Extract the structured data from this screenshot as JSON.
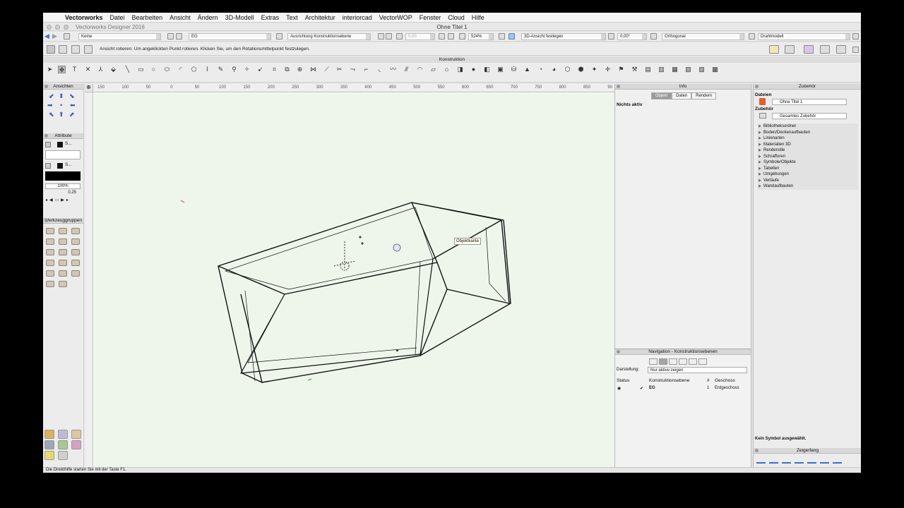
{
  "menubar": {
    "apple": "",
    "app": "Vectorworks",
    "items": [
      "Datei",
      "Bearbeiten",
      "Ansicht",
      "Ändern",
      "3D-Modell",
      "Extras",
      "Text",
      "Architektur",
      "interiorcad",
      "VectorWOP",
      "Fenster",
      "Cloud",
      "Hilfe"
    ]
  },
  "titlebar": {
    "app_version": "Vectorworks Designer 2016",
    "document": "Ohne Titel 1"
  },
  "modebar": {
    "klasse": "Keine",
    "ebene": "EG",
    "ausrichtung": "Ausrichtung Konstruktionsebene",
    "value_disabled": "0,00",
    "zoom": "524%",
    "ansicht": "3D-Ansicht festlegen",
    "winkel": "0,00°",
    "projektion": "Orthogonal",
    "darstellung": "Drahtmodell"
  },
  "hintbar": {
    "hint": "Ansicht rotieren: Um angeklickten Punkt rotieren. Klicken Sie, um den Rotationsmittelpunkt festzulegen."
  },
  "konstruktion": {
    "title": "Konstruktion"
  },
  "leftpanel": {
    "ansichten_title": "Ansichten",
    "attribute_title": "Attribute",
    "fill_label": "S...",
    "pen_label": "S...",
    "opacity": "100%",
    "line_weight": "0,25",
    "werkzeuggruppen_title": "Werkzeuggruppen"
  },
  "ruler": {
    "top_ticks": [
      "150",
      "100",
      "50",
      "0",
      "50",
      "100",
      "150",
      "200",
      "250",
      "300",
      "350",
      "400",
      "450",
      "500",
      "550",
      "600",
      "650",
      "700",
      "750",
      "800",
      "850",
      "90"
    ]
  },
  "canvas": {
    "tooltip": "Objektkante"
  },
  "info": {
    "title": "Info",
    "tabs": [
      "Objekt",
      "Daten",
      "Rendern"
    ],
    "status": "Nichts aktiv"
  },
  "nav": {
    "title": "Navigation - Konstruktionsebenen",
    "darstellung_label": "Darstellung:",
    "darstellung_value": "Nur aktive zeigen",
    "col_status": "Status",
    "col_ebene": "Konstruktionsebene",
    "col_nr": "#",
    "col_geschoss": "Geschoss",
    "row_check": "✔",
    "row_ebene": "EG",
    "row_nr": "1",
    "row_geschoss": "Erdgeschoss"
  },
  "zubehor": {
    "title": "Zubehör",
    "dateien_label": "Dateien",
    "datei_value": "Ohne Titel 1",
    "zubehor_label": "Zubehör",
    "zubehor_value": "Gesamtes Zubehör",
    "items": [
      "Bibliotheksordner",
      "Boden/Deckenaufbauten",
      "Linienarten",
      "Materialien 3D",
      "Renderstile",
      "Schraffuren",
      "Symbole/Objekte",
      "Tabellen",
      "Umgebungen",
      "Verläufe",
      "Wandaufbauten"
    ],
    "empty": "Kein Symbol ausgewählt.",
    "zeigerfang_title": "Zeigerfang"
  },
  "statusbar": {
    "text": "Die Direkthilfe starten Sie mit der Taste F1."
  },
  "colors": {
    "canvas_bg": "#eef6ec",
    "accent_blue": "#3a6fd0"
  }
}
